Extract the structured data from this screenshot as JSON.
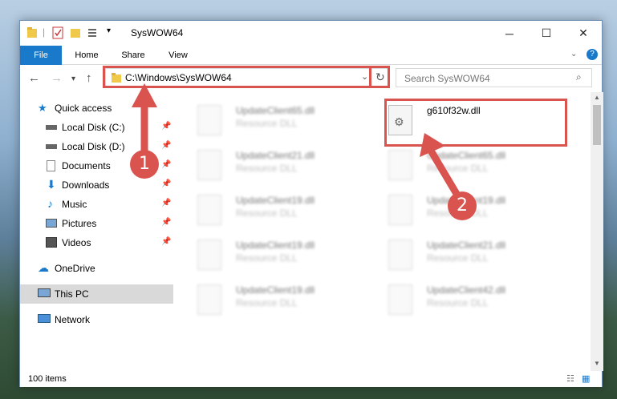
{
  "window": {
    "title": "SysWOW64",
    "controls": {
      "minimize": "─",
      "maximize": "☐",
      "close": "✕"
    }
  },
  "ribbon": {
    "tabs": [
      "File",
      "Home",
      "Share",
      "View"
    ]
  },
  "navigation": {
    "address": "C:\\Windows\\SysWOW64",
    "search_placeholder": "Search SysWOW64"
  },
  "sidebar": {
    "items": [
      {
        "label": "Quick access",
        "icon": "star-icon"
      },
      {
        "label": "Local Disk (C:)",
        "icon": "drive-icon"
      },
      {
        "label": "Local Disk (D:)",
        "icon": "drive-icon"
      },
      {
        "label": "Documents",
        "icon": "documents-icon"
      },
      {
        "label": "Downloads",
        "icon": "download-icon"
      },
      {
        "label": "Music",
        "icon": "music-icon"
      },
      {
        "label": "Pictures",
        "icon": "pictures-icon"
      },
      {
        "label": "Videos",
        "icon": "videos-icon"
      },
      {
        "label": "OneDrive",
        "icon": "cloud-icon"
      },
      {
        "label": "This PC",
        "icon": "computer-icon"
      },
      {
        "label": "Network",
        "icon": "network-icon"
      }
    ]
  },
  "files": [
    {
      "name": "UpdateClient65.dll",
      "type": "Resource DLL"
    },
    {
      "name": "g610f32w.dll",
      "type": ""
    },
    {
      "name": "UpdateClient21.dll",
      "type": "Resource DLL"
    },
    {
      "name": "UpdateClient65.dll",
      "type": "Resource DLL"
    },
    {
      "name": "UpdateClient19.dll",
      "type": "Resource DLL"
    },
    {
      "name": "UpdateClient19.dll",
      "type": "Resource DLL"
    },
    {
      "name": "UpdateClient19.dll",
      "type": "Resource DLL"
    },
    {
      "name": "UpdateClient21.dll",
      "type": "Resource DLL"
    },
    {
      "name": "UpdateClient19.dll",
      "type": "Resource DLL"
    },
    {
      "name": "UpdateClient42.dll",
      "type": "Resource DLL"
    }
  ],
  "status": {
    "item_count": "100 items"
  },
  "annotations": {
    "step1": "1",
    "step2": "2"
  },
  "colors": {
    "accent": "#1979ca",
    "highlight": "#d9534f"
  }
}
